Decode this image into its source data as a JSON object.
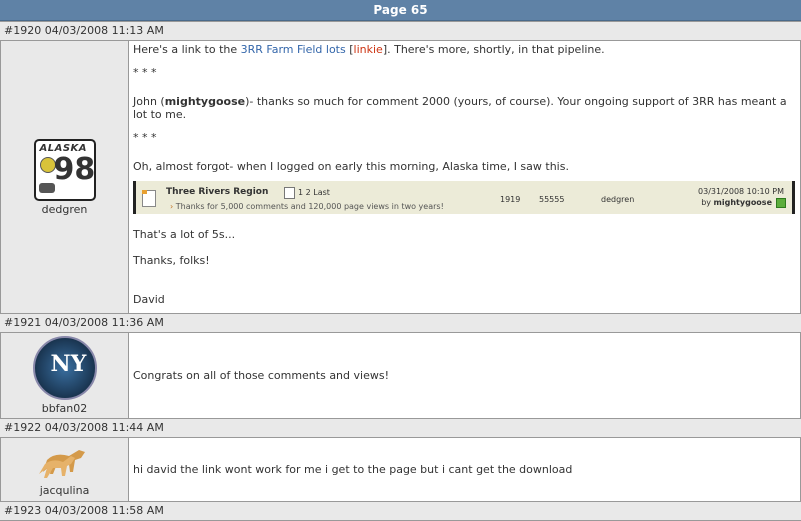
{
  "page_header": "Page 65",
  "posts": [
    {
      "header": "#1920 04/03/2008 11:13 AM",
      "username": "dedgren",
      "avatar": {
        "alt": "alaska-98-license-plate",
        "plate_state": "ALASKA",
        "plate_number": "98"
      },
      "body": {
        "p1_pre": "Here's a link to the ",
        "p1_link": "3RR Farm Field lots",
        "p1_bracket_open": " [",
        "p1_link2": "linkie",
        "p1_post": "]. There's more, shortly, in that pipeline.",
        "sep1": "* * *",
        "p2_pre": "John (",
        "p2_bold": "mightygoose",
        "p2_post": ")- thanks so much for comment 2000 (yours, of course). Your ongoing support of 3RR has meant a lot to me.",
        "sep2": "* * *",
        "p3": "Oh, almost forgot- when I logged on early this morning, Alaska time, I saw this.",
        "embed": {
          "title": "Three Rivers Region",
          "pages": "1 2 Last",
          "desc": "Thanks for 5,000 comments and 120,000 page views in two years!",
          "replies": "1919",
          "views": "55555",
          "author": "dedgren",
          "date": "03/31/2008 10:10 PM",
          "by_prefix": "by ",
          "by_user": "mightygoose"
        },
        "p4": "That's a lot of 5s...",
        "p5": "Thanks, folks!",
        "p6": "David"
      }
    },
    {
      "header": "#1921 04/03/2008 11:36 AM",
      "username": "bbfan02",
      "avatar": {
        "alt": "yankees-logo"
      },
      "body": {
        "p1": "Congrats on all of those comments and views!"
      }
    },
    {
      "header": "#1922 04/03/2008 11:44 AM",
      "username": "jacqulina",
      "avatar": {
        "alt": "horses-silhouette"
      },
      "body": {
        "p1": "hi david the link wont work for me i get to the page but i cant get the download"
      }
    },
    {
      "header": "#1923 04/03/2008 11:58 AM"
    }
  ]
}
